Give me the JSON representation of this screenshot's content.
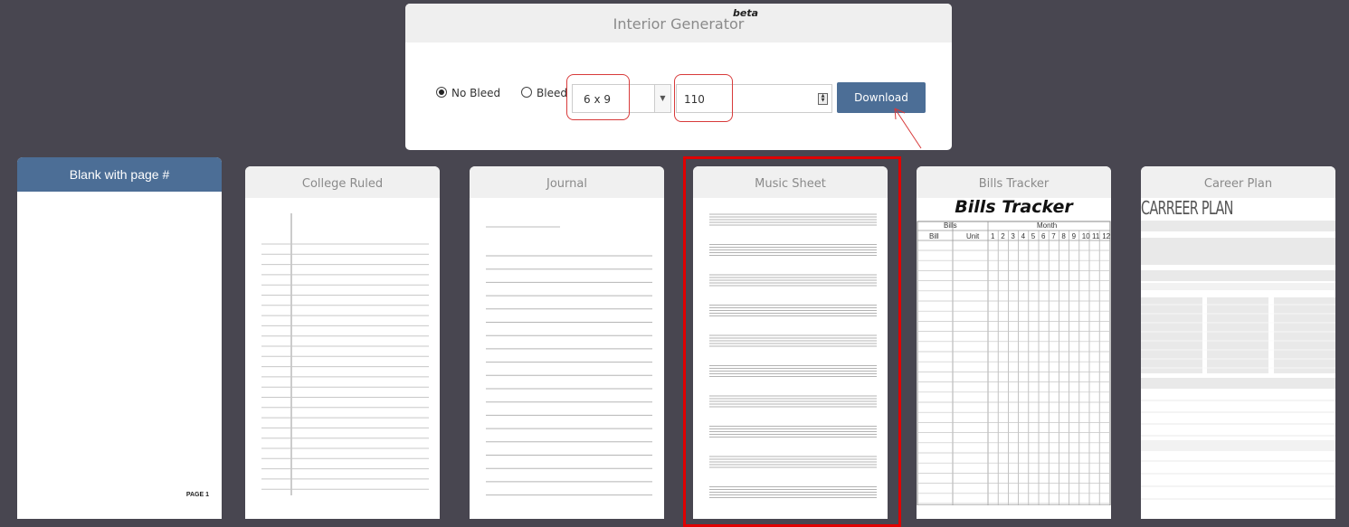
{
  "panel": {
    "title": "Interior Generator",
    "badge": "beta",
    "bleed_options": [
      {
        "label": "No Bleed",
        "checked": true
      },
      {
        "label": "Bleed",
        "checked": false
      }
    ],
    "size_select": {
      "value": "6 x 9"
    },
    "pages_input": {
      "value": "110"
    },
    "download_label": "Download"
  },
  "templates": [
    {
      "title": "Blank with page #",
      "selected": false,
      "footer": "PAGE 1"
    },
    {
      "title": "College Ruled",
      "selected": false
    },
    {
      "title": "Journal",
      "selected": false
    },
    {
      "title": "Music Sheet",
      "selected": true
    },
    {
      "title": "Bills Tracker",
      "selected": false,
      "preview": {
        "heading": "Bills Tracker",
        "group_left": "Bills",
        "group_right": "Month",
        "col_bill": "Bill",
        "col_unit": "Unit",
        "months": [
          "1",
          "2",
          "3",
          "4",
          "5",
          "6",
          "7",
          "8",
          "9",
          "10",
          "11",
          "12"
        ]
      }
    },
    {
      "title": "Career Plan",
      "selected": false,
      "preview": {
        "heading": "CARREER PLAN"
      }
    }
  ],
  "colors": {
    "accent": "#4c6e96",
    "highlight": "#e00000",
    "background": "#484650"
  }
}
